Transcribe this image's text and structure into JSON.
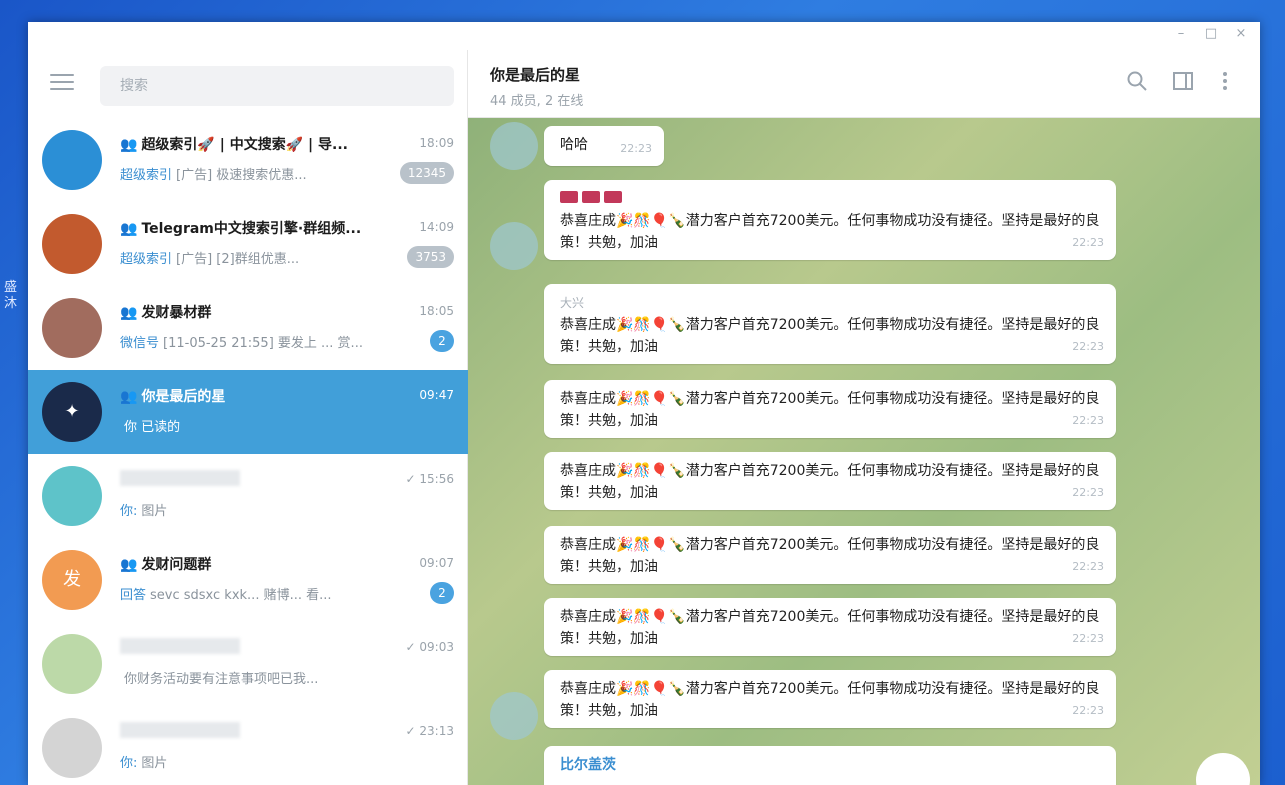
{
  "window": {
    "controls": {
      "minimize": "–",
      "maximize": "□",
      "close": "×"
    }
  },
  "sidebar": {
    "search_placeholder": "搜索",
    "chats": [
      {
        "title": "超级索引🚀 | 中文搜索🚀 | 导...",
        "time": "18:09",
        "sender": "超级索引",
        "preview": "[广告] 极速搜索优惠...",
        "badge": "12345",
        "avatar_color": "#2b8fd6",
        "avatar_text": "",
        "group": true,
        "active": false
      },
      {
        "title": "Telegram中文搜索引擎·群组频...",
        "time": "14:09",
        "sender": "超级索引",
        "preview": "[广告] [2]群组优惠...",
        "badge": "3753",
        "avatar_color": "#c25a2e",
        "avatar_text": "",
        "group": true,
        "active": false
      },
      {
        "title": "发财暴材群",
        "time": "18:05",
        "sender": "微信号",
        "preview": "[11-05-25 21:55] 要发上 ... 赏...",
        "badge": "2",
        "avatar_color": "#a16c5e",
        "avatar_text": "",
        "group": true,
        "active": false
      },
      {
        "title": "你是最后的星",
        "time": "09:47",
        "sender": "",
        "preview": "你 已读的",
        "badge": "",
        "avatar_color": "#1a2a4a",
        "avatar_text": "✦",
        "group": true,
        "active": true
      },
      {
        "title": "",
        "time": "✓ 15:56",
        "sender": "你:",
        "preview": "图片",
        "badge": "",
        "avatar_color": "#5ec3c9",
        "avatar_text": "",
        "group": false,
        "active": false
      },
      {
        "title": "发财问题群",
        "time": "09:07",
        "sender": "回答",
        "preview": "sevc sdsxc kxk... 赌博... 看...",
        "badge": "2",
        "avatar_color": "#f29b52",
        "avatar_text": "发",
        "group": true,
        "active": false
      },
      {
        "title": "",
        "time": "✓ 09:03",
        "sender": "",
        "preview": "你财务活动要有注意事项吧已我...",
        "badge": "",
        "avatar_color": "#bcd9a8",
        "avatar_text": "",
        "group": false,
        "active": false
      },
      {
        "title": "",
        "time": "✓ 23:13",
        "sender": "你:",
        "preview": "图片",
        "badge": "",
        "avatar_color": "#d4d4d4",
        "avatar_text": "",
        "group": false,
        "active": false
      }
    ]
  },
  "main": {
    "title": "你是最后的星",
    "subtitle": "44 成员, 2 在线",
    "icons": {
      "search": "search-icon",
      "sidebar_toggle": "panel-icon",
      "more": "more-icon"
    }
  },
  "messages": [
    {
      "sender": "",
      "text": "哈哈",
      "time": "22:23"
    },
    {
      "sender": "■■■",
      "text": "恭喜庄成🎉🎊🎈🍾潜力客户首充7200美元。任何事物成功没有捷径。坚持是最好的良策！共勉，加油",
      "time": "22:23"
    },
    {
      "sender": "大兴",
      "text": "恭喜庄成🎉🎊🎈🍾潜力客户首充7200美元。任何事物成功没有捷径。坚持是最好的良策！共勉，加油",
      "time": "22:23"
    },
    {
      "sender": "",
      "text": "恭喜庄成🎉🎊🎈🍾潜力客户首充7200美元。任何事物成功没有捷径。坚持是最好的良策！共勉，加油",
      "time": "22:23"
    },
    {
      "sender": "",
      "text": "恭喜庄成🎉🎊🎈🍾潜力客户首充7200美元。任何事物成功没有捷径。坚持是最好的良策！共勉，加油",
      "time": "22:23"
    },
    {
      "sender": "",
      "text": "恭喜庄成🎉🎊🎈🍾潜力客户首充7200美元。任何事物成功没有捷径。坚持是最好的良策！共勉，加油",
      "time": "22:23"
    },
    {
      "sender": "",
      "text": "恭喜庄成🎉🎊🎈🍾潜力客户首充7200美元。任何事物成功没有捷径。坚持是最好的良策！共勉，加油",
      "time": "22:23"
    },
    {
      "sender": "",
      "text": "恭喜庄成🎉🎊🎈🍾潜力客户首充7200美元。任何事物成功没有捷径。坚持是最好的良策！共勉，加油",
      "time": "22:23"
    },
    {
      "sender": "比尔盖茨",
      "text": "",
      "time": ""
    }
  ]
}
